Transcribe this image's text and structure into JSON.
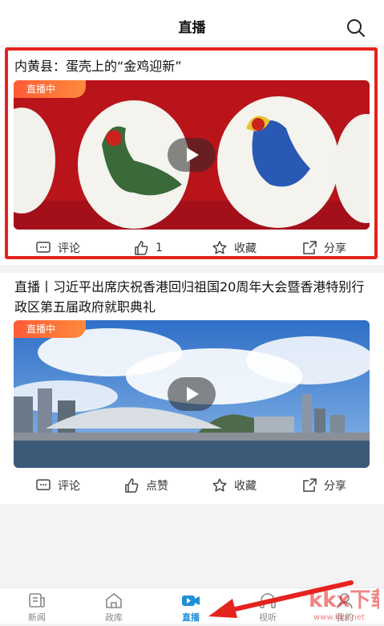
{
  "header": {
    "title": "直播"
  },
  "cards": [
    {
      "title": "内黄县：蛋壳上的“金鸡迎新”",
      "badge": "直播中",
      "actions": {
        "comment": "评论",
        "like": "1",
        "favorite": "收藏",
        "share": "分享"
      }
    },
    {
      "title": "直播丨习近平出席庆祝香港回归祖国20周年大会暨香港特别行政区第五届政府就职典礼",
      "badge": "直播中",
      "actions": {
        "comment": "评论",
        "like": "点赞",
        "favorite": "收藏",
        "share": "分享"
      }
    }
  ],
  "tabbar": [
    {
      "label": "新闻",
      "icon": "news-icon",
      "active": false
    },
    {
      "label": "政库",
      "icon": "home-icon",
      "active": false
    },
    {
      "label": "直播",
      "icon": "live-camera-icon",
      "active": true
    },
    {
      "label": "视听",
      "icon": "audio-icon",
      "active": false
    },
    {
      "label": "我的",
      "icon": "user-icon",
      "active": false
    }
  ],
  "watermark": {
    "text": "kkx下载",
    "url": "www.kkx.net"
  },
  "colors": {
    "accent": "#1f8fd6",
    "highlight": "#e5231e",
    "live_badge": "#ff6a3a"
  }
}
